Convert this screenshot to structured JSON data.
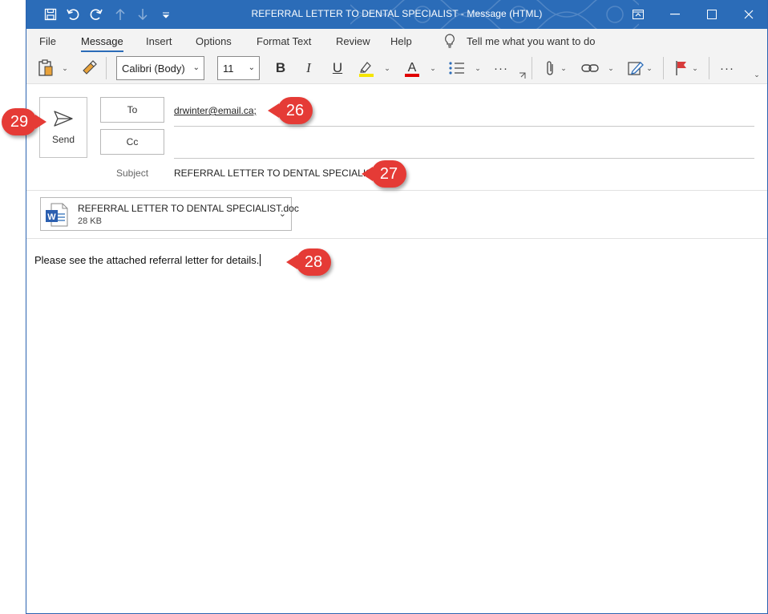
{
  "window": {
    "title": "REFERRAL LETTER TO DENTAL SPECIALIST  -  Message (HTML)"
  },
  "menu": {
    "tabs": [
      "File",
      "Message",
      "Insert",
      "Options",
      "Format Text",
      "Review",
      "Help"
    ],
    "active_tab": "Message",
    "tell_me": "Tell me what you want to do"
  },
  "ribbon": {
    "font_name": "Calibri (Body)",
    "font_size": "11",
    "bold": "B",
    "italic": "I",
    "underline": "U",
    "font_color_glyph": "A",
    "more": "···",
    "highlight_color": "#f5e500",
    "font_color": "#e00000"
  },
  "header": {
    "send_label": "Send",
    "to_label": "To",
    "cc_label": "Cc",
    "to_value": "drwinter@email.ca;",
    "cc_value": "",
    "subject_label": "Subject",
    "subject_value": "REFERRAL LETTER TO DENTAL SPECIALIST"
  },
  "attachment": {
    "name": "REFERRAL LETTER TO DENTAL SPECIALIST.doc",
    "size": "28 KB"
  },
  "body": {
    "text": "Please see the attached referral letter for details."
  },
  "callouts": {
    "to": "26",
    "subject": "27",
    "body": "28",
    "send": "29"
  },
  "colors": {
    "titlebar": "#2b6cb8",
    "callout": "#e53b36"
  }
}
